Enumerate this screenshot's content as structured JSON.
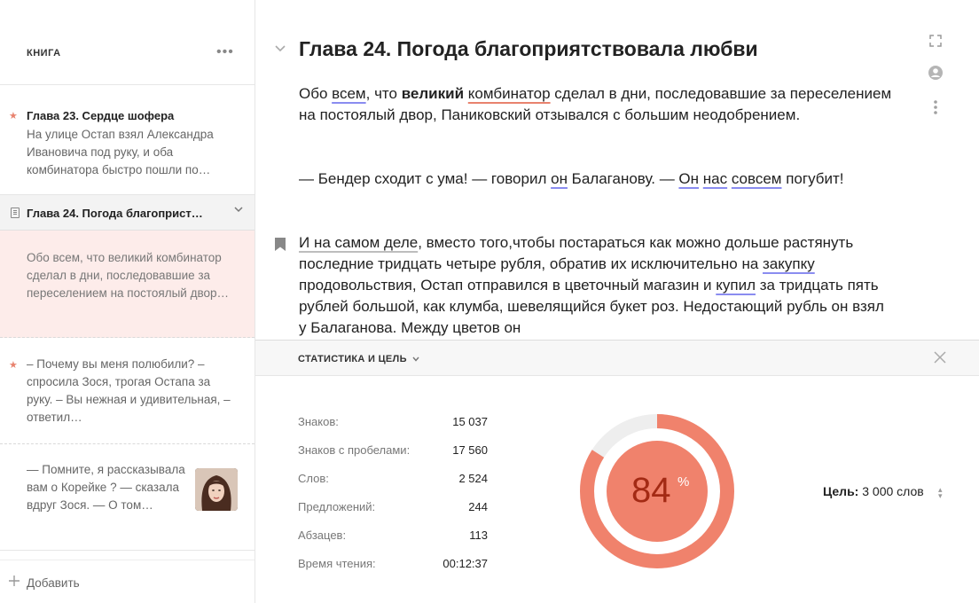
{
  "sidebar": {
    "title": "КНИГА",
    "more": "•••",
    "items": [
      {
        "title": "Глава 23. Сердце шофера",
        "text": "На улице Остап взял Александра Ивановича под руку, и оба комбинатора быстро пошли по…"
      },
      {
        "title": "Глава 24. Погода благоприст…"
      },
      {
        "text": "Обо всем, что великий комбинатор сделал в дни, последовавшие за переселением на постоялый двор…"
      },
      {
        "text": "– Почему вы меня полюбили? – спросила Зося, трогая Остапа за руку. – Вы нежная и удивительная, – ответил…"
      },
      {
        "text": "— Помните, я рассказывала вам о Корейке ? — сказала вдруг Зося. — О том…"
      }
    ],
    "add_label": "Добавить"
  },
  "editor": {
    "chapter_title": "Глава 24. Погода благоприятствовала любви",
    "p1": {
      "a": "Обо ",
      "b": "всем",
      "c": ", что ",
      "d": "великий",
      "e": " ",
      "f": "комбинатор",
      "g": " сделал в дни, последовавшие за переселением на постоялый двор, Паниковский отзывался с большим неодобрением."
    },
    "p2": {
      "a": "— Бендер сходит с ума! — говорил ",
      "b": "он",
      "c": " Балаганову. — ",
      "d": "Он",
      "e": " ",
      "f": "нас",
      "g": " ",
      "h": "совсем",
      "i": " погубит!"
    },
    "p3": {
      "a": "И на самом деле",
      "b": ", вместо того,чтобы постараться как можно дольше растянуть последние тридцать четыре рубля, обратив их исключительно на ",
      "c": "закупку",
      "d": " продовольствия, Остап отправился в цветочный магазин и ",
      "e": "купил",
      "f": " за тридцать пять рублей большой, как клумба, шевелящийся букет роз. Недостающий рубль он взял у Балаганова. Между цветов он"
    }
  },
  "stats": {
    "title": "СТАТИСТИКА И ЦЕЛЬ",
    "rows": [
      {
        "label": "Знаков:",
        "value": "15 037"
      },
      {
        "label": "Знаков с пробелами:",
        "value": "17 560"
      },
      {
        "label": "Слов:",
        "value": "2 524"
      },
      {
        "label": "Предложений:",
        "value": "244"
      },
      {
        "label": "Абзацев:",
        "value": "113"
      },
      {
        "label": "Время чтения:",
        "value": "00:12:37"
      }
    ],
    "percent": "84",
    "percent_sign": "%",
    "percent_value": 0.84,
    "goal_label": "Цель:",
    "goal_value": "3 000 слов"
  },
  "colors": {
    "accent": "#f0826c",
    "accent_dark": "#a32a14",
    "underline_blue": "#8a8cf0",
    "selected_bg": "#fdecea"
  },
  "icons": [
    "more-icon",
    "star-icon",
    "doc-icon",
    "chevron-down-icon",
    "plus-icon",
    "bookmark-icon",
    "fullscreen-icon",
    "user-icon",
    "dots-vertical-icon",
    "close-icon",
    "stepper-icon"
  ]
}
